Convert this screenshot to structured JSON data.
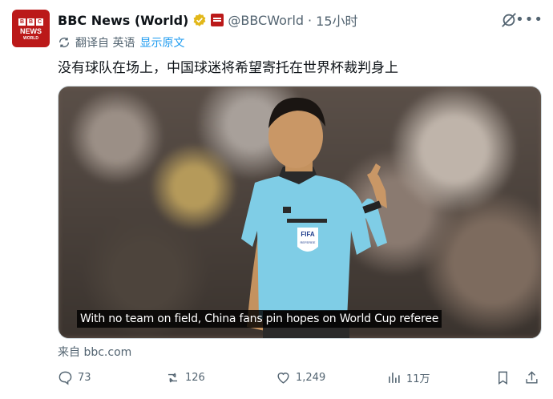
{
  "account": {
    "avatar_logo_letters": [
      "B",
      "B",
      "C"
    ],
    "avatar_news": "NEWS",
    "avatar_world": "WORLD",
    "name": "BBC News (World)",
    "handle": "@BBCWorld",
    "separator": "·",
    "time": "15小时"
  },
  "translation": {
    "label": "翻译自 英语",
    "show_original": "显示原文"
  },
  "post": {
    "text": "没有球队在场上，中国球迷将希望寄托在世界杯裁判身上",
    "media_caption": "With no team on field, China fans pin hopes on World Cup referee",
    "jersey_badge": "FIFA",
    "jersey_badge_sub": "REFEREE",
    "source": "来自 bbc.com"
  },
  "actions": {
    "replies": "73",
    "reposts": "126",
    "likes": "1,249",
    "views": "11万"
  },
  "colors": {
    "accent": "#1d9bf0",
    "muted": "#536471",
    "bbc_red": "#bb1919",
    "verified_gold": "#e2b719"
  }
}
